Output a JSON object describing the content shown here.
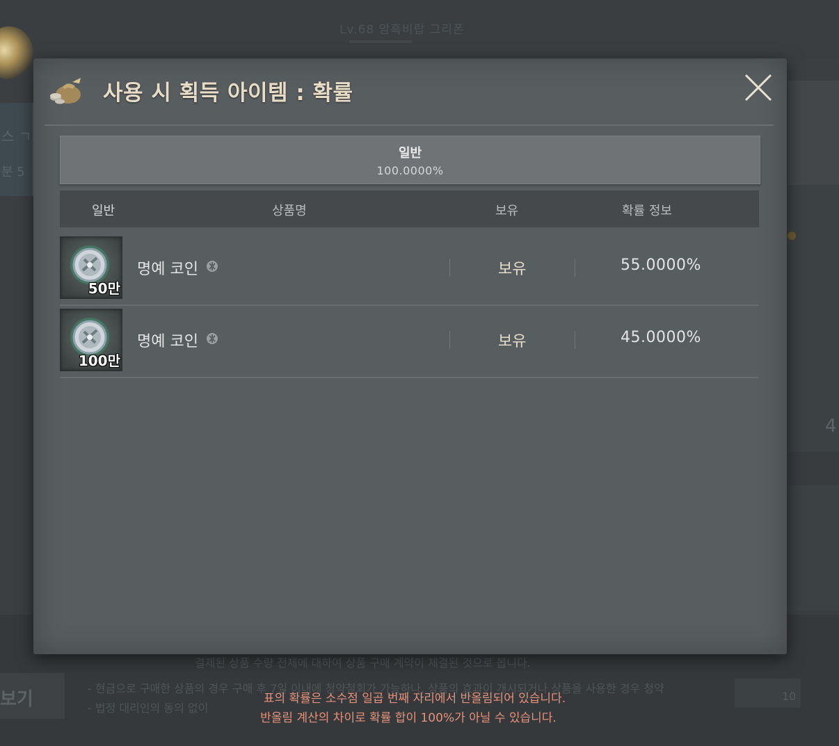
{
  "background": {
    "title": "Lv.68 암흑비랍 그리폰",
    "left_text_1": "스 ㄱ",
    "left_text_2": "분 5",
    "right_number": "4",
    "bottom_button": "보기",
    "bottom_lines": [
      "결제된 상품 수량 전체에 대하여 상품 구매 계약이 체결된 것으로 봅니다.",
      "- 현금으로 구매한 상품의 경우 구매 후 7일 이내에 청약철회가 가능하나, 상품의 효과이 개시되거나 상품을 사용한 경우 청약",
      "- 법정 대리인의 동의 없이"
    ],
    "bottom_tag_number": "10"
  },
  "modal": {
    "title": "사용 시 획득 아이템 : 확률",
    "title_icon": "pouch-icon",
    "close_icon": "close-icon",
    "summary": {
      "label": "일반",
      "value": "100.0000%"
    },
    "columns": [
      "일반",
      "상품명",
      "보유",
      "확률 정보"
    ],
    "rows": [
      {
        "icon": "honor-coin-icon",
        "quantity": "50만",
        "name": "명예 코인",
        "owned": "보유",
        "probability": "55.0000%"
      },
      {
        "icon": "honor-coin-icon",
        "quantity": "100만",
        "name": "명예 코인",
        "owned": "보유",
        "probability": "45.0000%"
      }
    ]
  },
  "notice": {
    "line1": "표의 확률은 소수점 일곱 번째 자리에서 반올림되어 있습니다.",
    "line2": "반올림 계산의 차이로 확률 합이 100%가 아닐 수 있습니다."
  },
  "colors": {
    "modal_bg": "#585d60",
    "title_text": "#e7ddc7",
    "notice_text": "#e6917a"
  }
}
